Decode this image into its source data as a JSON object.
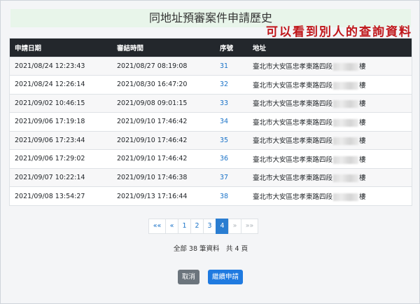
{
  "page": {
    "title": "同地址預審案件申請歷史",
    "annotation": "可以看到別人的查詢資料"
  },
  "table": {
    "headers": [
      "申請日期",
      "審結時間",
      "序號",
      "地址"
    ],
    "rows": [
      {
        "apply": "2021/08/24 12:23:43",
        "review": "2021/08/27 08:19:08",
        "seq": "31",
        "addr": "臺北市大安區忠孝東路四段",
        "floor": "樓"
      },
      {
        "apply": "2021/08/24 12:26:14",
        "review": "2021/08/30 16:47:20",
        "seq": "32",
        "addr": "臺北市大安區忠孝東路四段",
        "floor": "樓"
      },
      {
        "apply": "2021/09/02 10:46:15",
        "review": "2021/09/08 09:01:15",
        "seq": "33",
        "addr": "臺北市大安區忠孝東路四段",
        "floor": "樓"
      },
      {
        "apply": "2021/09/06 17:19:18",
        "review": "2021/09/10 17:46:42",
        "seq": "34",
        "addr": "臺北市大安區忠孝東路四段",
        "floor": "樓"
      },
      {
        "apply": "2021/09/06 17:23:44",
        "review": "2021/09/10 17:46:42",
        "seq": "35",
        "addr": "臺北市大安區忠孝東路四段",
        "floor": "樓"
      },
      {
        "apply": "2021/09/06 17:29:02",
        "review": "2021/09/10 17:46:42",
        "seq": "36",
        "addr": "臺北市大安區忠孝東路四段",
        "floor": "樓"
      },
      {
        "apply": "2021/09/07 10:22:14",
        "review": "2021/09/10 17:46:38",
        "seq": "37",
        "addr": "臺北市大安區忠孝東路四段",
        "floor": "樓"
      },
      {
        "apply": "2021/09/08 13:54:27",
        "review": "2021/09/13 17:16:44",
        "seq": "38",
        "addr": "臺北市大安區忠孝東路四段",
        "floor": "樓"
      }
    ]
  },
  "pagination": {
    "first": "««",
    "prev": "«",
    "pages": [
      "1",
      "2",
      "3",
      "4"
    ],
    "current": "4",
    "next": "»",
    "last": "»»"
  },
  "summary": "全部 38 筆資料　共 4 頁",
  "buttons": {
    "cancel": "取消",
    "continue": "繼續申請"
  }
}
